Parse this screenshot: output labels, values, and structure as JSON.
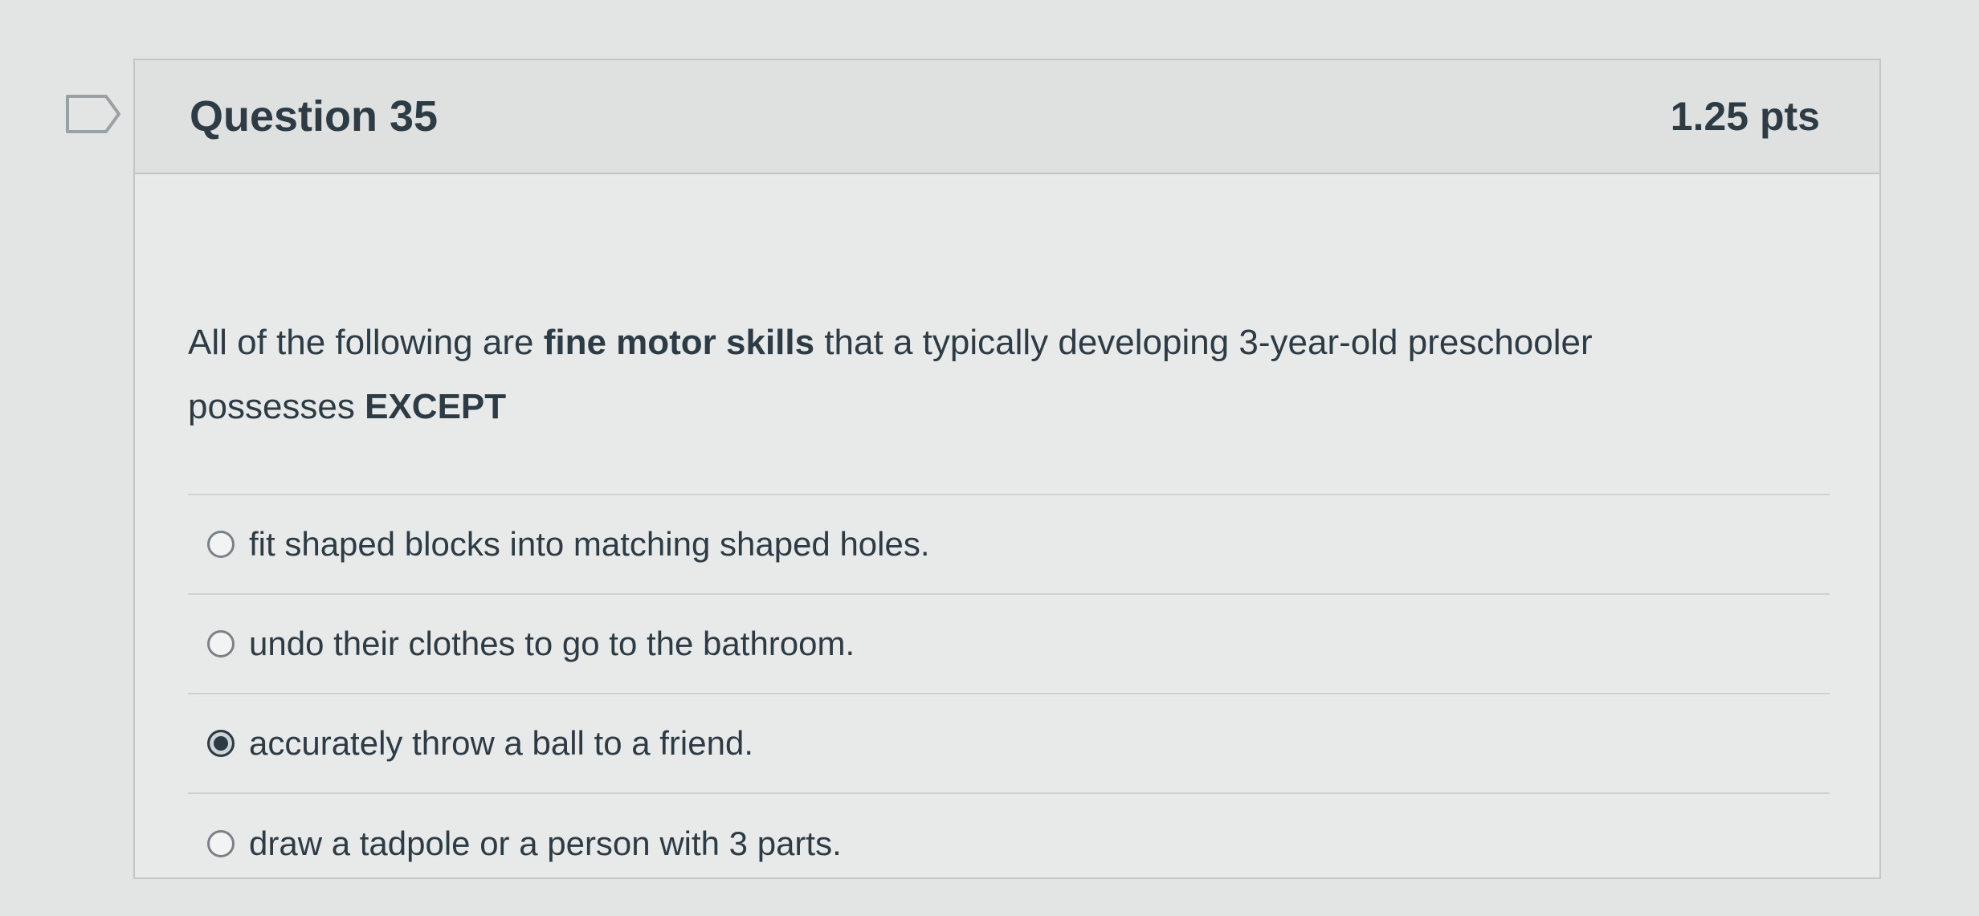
{
  "question": {
    "title": "Question 35",
    "points": "1.25 pts",
    "text_parts": [
      "All of the following are ",
      "fine motor skills",
      " that a typically developing 3-year-old preschooler possesses ",
      "EXCEPT"
    ]
  },
  "answers": [
    {
      "label": "fit shaped blocks into matching shaped holes.",
      "selected": false
    },
    {
      "label": "undo their clothes to go to the bathroom.",
      "selected": false
    },
    {
      "label": "accurately throw a ball to a friend.",
      "selected": true
    },
    {
      "label": "draw a tadpole or a person with 3 parts.",
      "selected": false
    }
  ],
  "icons": {
    "flag": "flag-question-icon",
    "radio": "radio-button-icon"
  },
  "colors": {
    "text": "#2d3b45",
    "border": "#c3c6c5",
    "background": "#e3e5e4"
  }
}
